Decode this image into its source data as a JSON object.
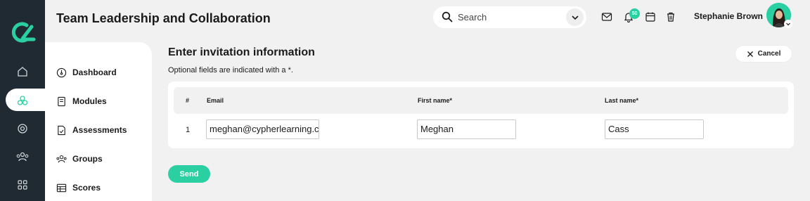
{
  "header": {
    "title": "Team Leadership and Collaboration",
    "search_placeholder": "Search",
    "notification_count": "50",
    "user_name": "Stephanie Brown"
  },
  "rail": {
    "items": [
      "home-icon",
      "modules-icon",
      "target-icon",
      "people-icon",
      "grid-icon"
    ],
    "active": "modules-icon"
  },
  "sidebar": {
    "items": [
      {
        "label": "Dashboard",
        "icon": "dashboard-icon"
      },
      {
        "label": "Modules",
        "icon": "book-icon"
      },
      {
        "label": "Assessments",
        "icon": "assessment-icon"
      },
      {
        "label": "Groups",
        "icon": "groups-icon"
      },
      {
        "label": "Scores",
        "icon": "table-icon"
      }
    ]
  },
  "main": {
    "title": "Enter invitation information",
    "subtitle": "Optional fields are indicated with a *.",
    "cancel_label": "Cancel",
    "table": {
      "headers": [
        "#",
        "Email",
        "First name*",
        "Last name*"
      ],
      "rows": [
        {
          "num": "1",
          "email": "meghan@cypherlearning.com",
          "first_name": "Meghan",
          "last_name": "Cass"
        }
      ]
    },
    "send_label": "Send"
  },
  "colors": {
    "accent": "#2bd0a2",
    "rail_bg": "#1f2a33",
    "page_bg": "#f1f1f1"
  }
}
